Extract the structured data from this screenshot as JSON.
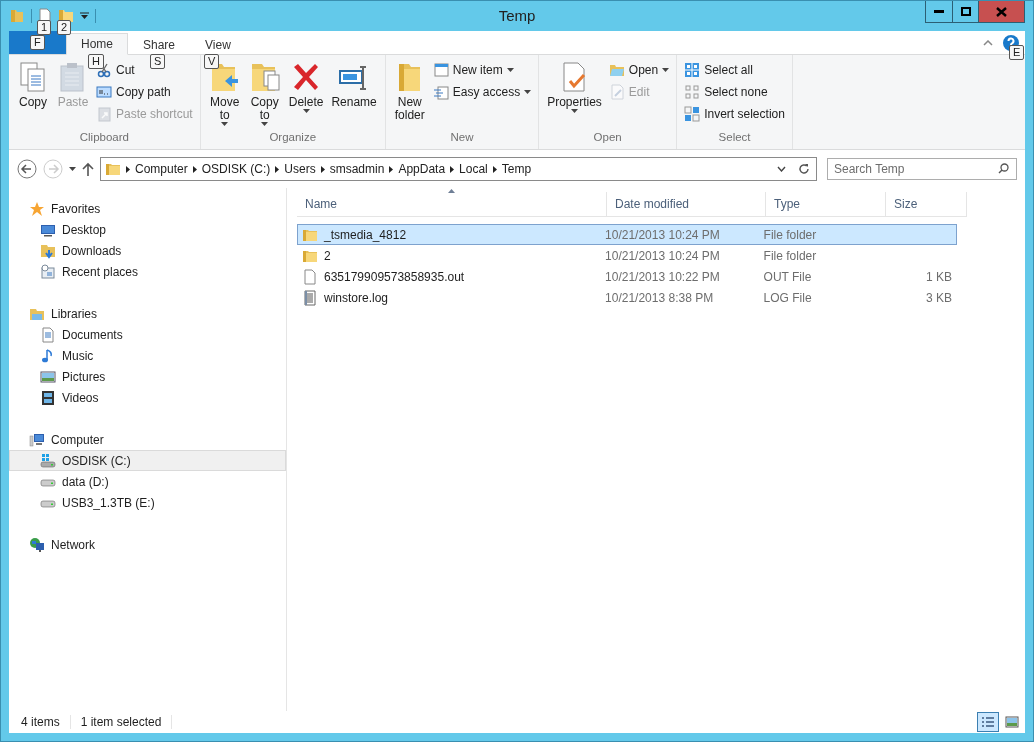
{
  "window": {
    "title": "Temp"
  },
  "quick_access_keytips": [
    "1",
    "2"
  ],
  "file_tab": {
    "keytip": "F"
  },
  "tabs": [
    {
      "label": "Home",
      "selected": true,
      "keytip": "H"
    },
    {
      "label": "Share",
      "selected": false,
      "keytip": "S"
    },
    {
      "label": "View",
      "selected": false,
      "keytip": "V"
    }
  ],
  "help": {
    "keytip": "E"
  },
  "ribbon_groups": [
    {
      "name": "Clipboard",
      "items": [
        {
          "kind": "large",
          "label": "Copy",
          "disabled": false,
          "dropdown": false
        },
        {
          "kind": "large",
          "label": "Paste",
          "disabled": true,
          "dropdown": false
        },
        {
          "kind": "small",
          "label": "Cut",
          "disabled": false,
          "dropdown": false
        },
        {
          "kind": "small",
          "label": "Copy path",
          "disabled": false,
          "dropdown": false
        },
        {
          "kind": "small",
          "label": "Paste shortcut",
          "disabled": true,
          "dropdown": false
        }
      ]
    },
    {
      "name": "Organize",
      "items": [
        {
          "kind": "large",
          "label": "Move to",
          "disabled": false,
          "dropdown": true
        },
        {
          "kind": "large",
          "label": "Copy to",
          "disabled": false,
          "dropdown": true
        },
        {
          "kind": "large",
          "label": "Delete",
          "disabled": false,
          "dropdown": true
        },
        {
          "kind": "large",
          "label": "Rename",
          "disabled": false,
          "dropdown": false
        }
      ]
    },
    {
      "name": "New",
      "items": [
        {
          "kind": "large",
          "label": "New folder",
          "disabled": false,
          "dropdown": false
        },
        {
          "kind": "small",
          "label": "New item",
          "disabled": false,
          "dropdown": true
        },
        {
          "kind": "small",
          "label": "Easy access",
          "disabled": false,
          "dropdown": true
        }
      ]
    },
    {
      "name": "Open",
      "items": [
        {
          "kind": "large",
          "label": "Properties",
          "disabled": false,
          "dropdown": true
        },
        {
          "kind": "small",
          "label": "Open",
          "disabled": false,
          "dropdown": true
        },
        {
          "kind": "small",
          "label": "Edit",
          "disabled": true,
          "dropdown": false
        }
      ]
    },
    {
      "name": "Select",
      "items": [
        {
          "kind": "small",
          "label": "Select all",
          "disabled": false,
          "dropdown": false
        },
        {
          "kind": "small",
          "label": "Select none",
          "disabled": false,
          "dropdown": false
        },
        {
          "kind": "small",
          "label": "Invert selection",
          "disabled": false,
          "dropdown": false
        }
      ]
    }
  ],
  "navigation": {
    "back_disabled": false,
    "forward_disabled": true
  },
  "breadcrumb": [
    "Computer",
    "OSDISK (C:)",
    "Users",
    "smsadmin",
    "AppData",
    "Local",
    "Temp"
  ],
  "search": {
    "placeholder": "Search Temp"
  },
  "sidebar": {
    "groups": [
      {
        "label": "Favorites",
        "children": [
          {
            "label": "Desktop",
            "selected": false
          },
          {
            "label": "Downloads",
            "selected": false
          },
          {
            "label": "Recent places",
            "selected": false
          }
        ]
      },
      {
        "label": "Libraries",
        "children": [
          {
            "label": "Documents",
            "selected": false
          },
          {
            "label": "Music",
            "selected": false
          },
          {
            "label": "Pictures",
            "selected": false
          },
          {
            "label": "Videos",
            "selected": false
          }
        ]
      },
      {
        "label": "Computer",
        "children": [
          {
            "label": "OSDISK (C:)",
            "selected": true
          },
          {
            "label": "data (D:)",
            "selected": false
          },
          {
            "label": "USB3_1.3TB (E:)",
            "selected": false
          }
        ]
      },
      {
        "label": "Network"
      }
    ]
  },
  "table": {
    "columns": [
      {
        "label": "Name",
        "sorted": true
      },
      {
        "label": "Date modified",
        "sorted": false
      },
      {
        "label": "Type",
        "sorted": false
      },
      {
        "label": "Size",
        "sorted": false
      }
    ],
    "rows": [
      {
        "kind": "folder",
        "name": "_tsmedia_4812",
        "date": "10/21/2013 10:24 PM",
        "type": "File folder",
        "selected": true
      },
      {
        "kind": "folder",
        "name": "2",
        "date": "10/21/2013 10:24 PM",
        "type": "File folder",
        "selected": false
      },
      {
        "kind": "file",
        "name": "635179909573858935.out",
        "date": "10/21/2013 10:22 PM",
        "type": "OUT File",
        "size": "1 KB",
        "selected": false
      },
      {
        "kind": "log",
        "name": "winstore.log",
        "date": "10/21/2013 8:38 PM",
        "type": "LOG File",
        "size": "3 KB",
        "selected": false
      }
    ]
  },
  "status_bar": {
    "items": "4 items",
    "selection": "1 item selected",
    "views": [
      {
        "kind": "details",
        "selected": true
      },
      {
        "kind": "large-icons",
        "selected": false
      }
    ]
  }
}
